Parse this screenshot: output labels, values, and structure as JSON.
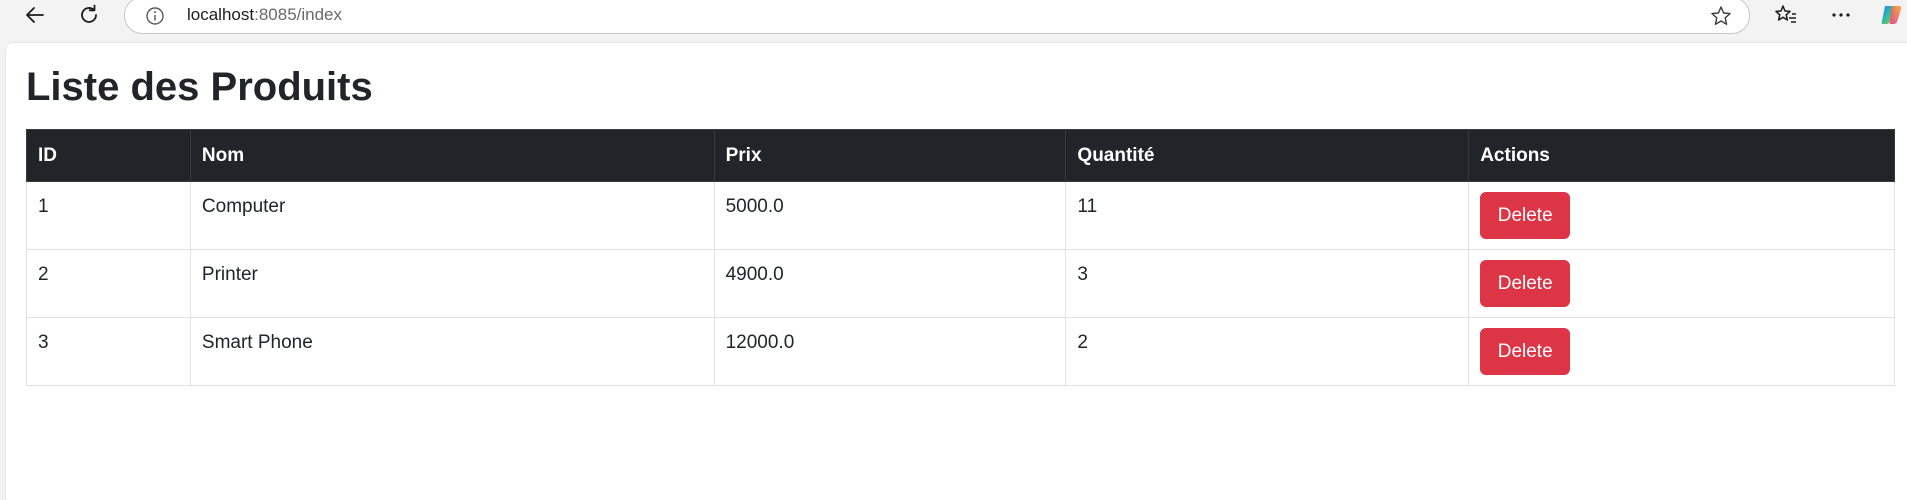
{
  "browser": {
    "url_host": "localhost",
    "url_path": ":8085/index",
    "icons": {
      "back": "back-arrow-icon",
      "refresh": "refresh-icon",
      "site_info": "info-icon",
      "favorite": "star-icon",
      "favorites_list": "favorites-icon",
      "menu": "more-icon",
      "copilot": "copilot-icon"
    }
  },
  "page": {
    "title": "Liste des Produits"
  },
  "table": {
    "headers": [
      "ID",
      "Nom",
      "Prix",
      "Quantité",
      "Actions"
    ],
    "rows": [
      {
        "id": "1",
        "nom": "Computer",
        "prix": "5000.0",
        "quantite": "11",
        "action_label": "Delete"
      },
      {
        "id": "2",
        "nom": "Printer",
        "prix": "4900.0",
        "quantite": "3",
        "action_label": "Delete"
      },
      {
        "id": "3",
        "nom": "Smart Phone",
        "prix": "12000.0",
        "quantite": "2",
        "action_label": "Delete"
      }
    ]
  },
  "colors": {
    "header_bg": "#212529",
    "delete_button": "#dc3545"
  }
}
